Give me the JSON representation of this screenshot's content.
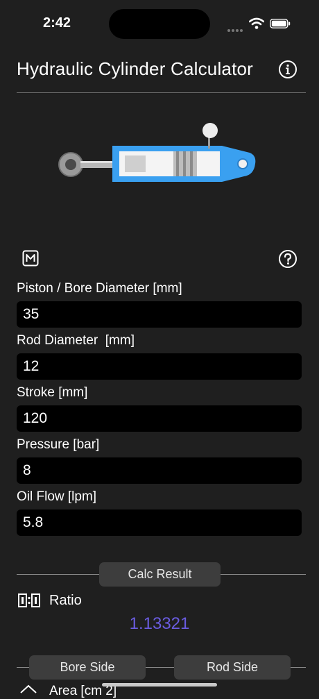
{
  "status_bar": {
    "time": "2:42"
  },
  "header": {
    "title": "Hydraulic Cylinder Calculator"
  },
  "inputs": [
    {
      "label": "Piston / Bore Diameter [mm]",
      "value": "35"
    },
    {
      "label": "Rod Diameter  [mm]",
      "value": "12"
    },
    {
      "label": "Stroke [mm]",
      "value": "120"
    },
    {
      "label": "Pressure [bar]",
      "value": "8"
    },
    {
      "label": "Oil Flow [lpm]",
      "value": "5.8"
    }
  ],
  "calc": {
    "button_label": "Calc Result"
  },
  "ratio": {
    "label": "Ratio",
    "value": "1.13321"
  },
  "sides": {
    "bore_label": "Bore Side",
    "rod_label": "Rod Side"
  },
  "area": {
    "label": "Area [cm 2]"
  },
  "colors": {
    "accent": "#6a5ce0",
    "cylinder_blue": "#3aa0f0",
    "background": "#1f1f1f"
  }
}
